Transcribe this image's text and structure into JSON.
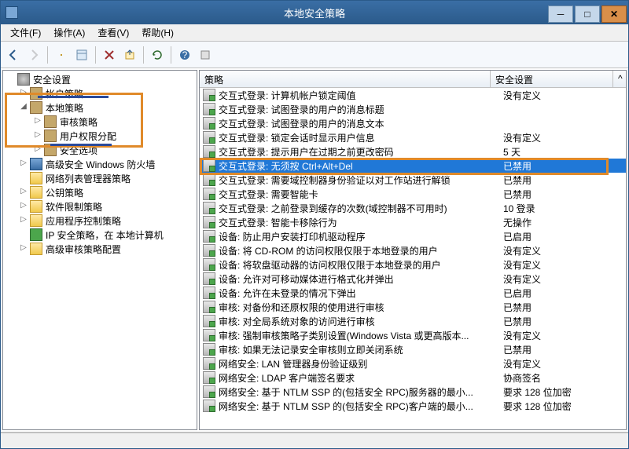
{
  "window": {
    "title": "本地安全策略"
  },
  "menu": {
    "file": "文件(F)",
    "action": "操作(A)",
    "view": "查看(V)",
    "help": "帮助(H)"
  },
  "tree": {
    "root": "安全设置",
    "items": [
      {
        "label": "帐户策略",
        "icon": "book",
        "expand": "▷"
      },
      {
        "label": "本地策略",
        "icon": "book",
        "expand": "◢"
      },
      {
        "label": "审核策略",
        "icon": "book",
        "indent": 2,
        "expand": "▷"
      },
      {
        "label": "用户权限分配",
        "icon": "book",
        "indent": 2,
        "expand": "▷"
      },
      {
        "label": "安全选项",
        "icon": "book",
        "indent": 2,
        "expand": "▷"
      },
      {
        "label": "高级安全 Windows 防火墙",
        "icon": "shield",
        "expand": "▷"
      },
      {
        "label": "网络列表管理器策略",
        "icon": "folder"
      },
      {
        "label": "公钥策略",
        "icon": "folder",
        "expand": "▷"
      },
      {
        "label": "软件限制策略",
        "icon": "folder",
        "expand": "▷"
      },
      {
        "label": "应用程序控制策略",
        "icon": "folder",
        "expand": "▷"
      },
      {
        "label": "IP 安全策略，在 本地计算机",
        "icon": "ip"
      },
      {
        "label": "高级审核策略配置",
        "icon": "folder",
        "expand": "▷"
      }
    ]
  },
  "columns": {
    "name": "策略",
    "setting": "安全设置"
  },
  "rows": [
    {
      "name": "交互式登录: 计算机帐户锁定阈值",
      "setting": "没有定义"
    },
    {
      "name": "交互式登录: 试图登录的用户的消息标题",
      "setting": ""
    },
    {
      "name": "交互式登录: 试图登录的用户的消息文本",
      "setting": ""
    },
    {
      "name": "交互式登录: 锁定会话时显示用户信息",
      "setting": "没有定义"
    },
    {
      "name": "交互式登录: 提示用户在过期之前更改密码",
      "setting": "5 天"
    },
    {
      "name": "交互式登录: 无须按 Ctrl+Alt+Del",
      "setting": "已禁用",
      "selected": true
    },
    {
      "name": "交互式登录: 需要域控制器身份验证以对工作站进行解锁",
      "setting": "已禁用"
    },
    {
      "name": "交互式登录: 需要智能卡",
      "setting": "已禁用"
    },
    {
      "name": "交互式登录: 之前登录到缓存的次数(域控制器不可用时)",
      "setting": "10 登录"
    },
    {
      "name": "交互式登录: 智能卡移除行为",
      "setting": "无操作"
    },
    {
      "name": "设备: 防止用户安装打印机驱动程序",
      "setting": "已启用"
    },
    {
      "name": "设备: 将 CD-ROM 的访问权限仅限于本地登录的用户",
      "setting": "没有定义"
    },
    {
      "name": "设备: 将软盘驱动器的访问权限仅限于本地登录的用户",
      "setting": "没有定义"
    },
    {
      "name": "设备: 允许对可移动媒体进行格式化并弹出",
      "setting": "没有定义"
    },
    {
      "name": "设备: 允许在未登录的情况下弹出",
      "setting": "已启用"
    },
    {
      "name": "审核: 对备份和还原权限的使用进行审核",
      "setting": "已禁用"
    },
    {
      "name": "审核: 对全局系统对象的访问进行审核",
      "setting": "已禁用"
    },
    {
      "name": "审核: 强制审核策略子类别设置(Windows Vista 或更高版本...",
      "setting": "没有定义"
    },
    {
      "name": "审核: 如果无法记录安全审核则立即关闭系统",
      "setting": "已禁用"
    },
    {
      "name": "网络安全: LAN 管理器身份验证级别",
      "setting": "没有定义"
    },
    {
      "name": "网络安全: LDAP 客户端签名要求",
      "setting": "协商签名"
    },
    {
      "name": "网络安全: 基于 NTLM SSP 的(包括安全 RPC)服务器的最小...",
      "setting": "要求 128 位加密"
    },
    {
      "name": "网络安全: 基于 NTLM SSP 的(包括安全 RPC)客户端的最小...",
      "setting": "要求 128 位加密"
    }
  ]
}
